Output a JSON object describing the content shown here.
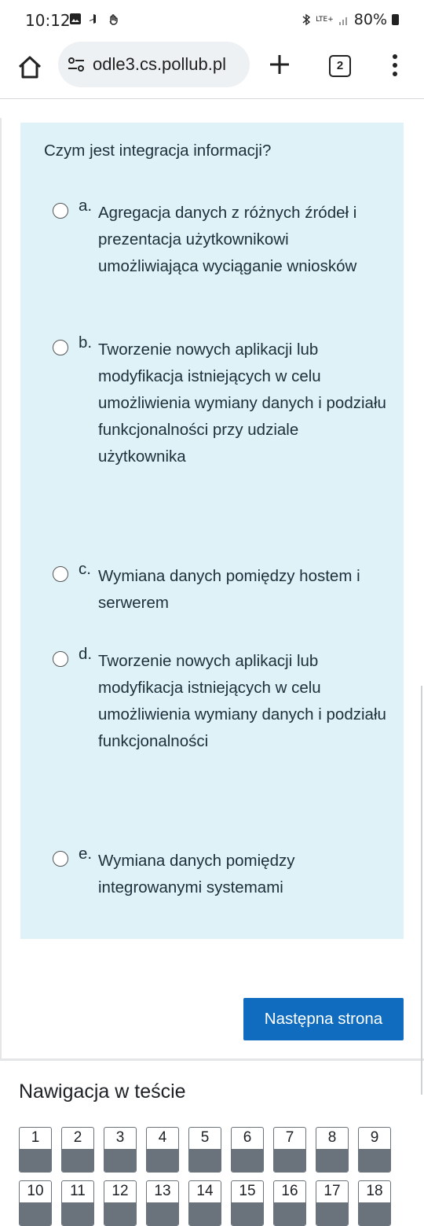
{
  "status_bar": {
    "time": "10:12",
    "network": "LTE+",
    "battery": "80%"
  },
  "browser": {
    "url": "odle3.cs.pollub.pl",
    "tab_count": "2"
  },
  "question": {
    "text": "Czym jest integracja informacji?",
    "answers": [
      {
        "letter": "a.",
        "text": "Agregacja danych z różnych źródeł i prezentacja użytkownikowi umożliwiająca wyciąganie wniosków"
      },
      {
        "letter": "b.",
        "text": "Tworzenie nowych aplikacji lub modyfikacja istniejących w celu umożliwienia wymiany danych i podziału funkcjonalności przy udziale użytkownika"
      },
      {
        "letter": "c.",
        "text": "Wymiana danych pomiędzy hostem i serwerem"
      },
      {
        "letter": "d.",
        "text": "Tworzenie nowych aplikacji lub modyfikacja istniejących w celu umożliwienia wymiany danych i podziału funkcjonalności"
      },
      {
        "letter": "e.",
        "text": "Wymiana danych pomiędzy integrowanymi systemami"
      }
    ]
  },
  "next_button": "Następna strona",
  "quiz_nav": {
    "title": "Nawigacja w teście",
    "items": [
      "1",
      "2",
      "3",
      "4",
      "5",
      "6",
      "7",
      "8",
      "9",
      "10",
      "11",
      "12",
      "13",
      "14",
      "15",
      "16",
      "17",
      "18"
    ]
  }
}
